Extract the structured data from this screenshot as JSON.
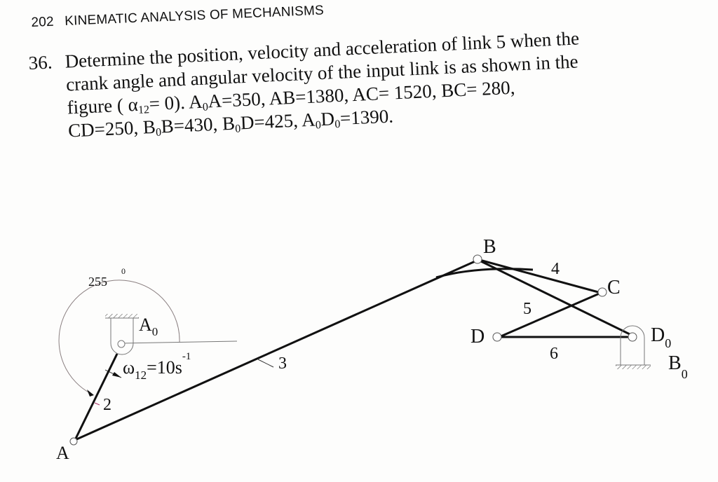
{
  "header": {
    "page_number": "202",
    "chapter_title": "KINEMATIC ANALYSIS OF MECHANISMS"
  },
  "problem": {
    "number": "36.",
    "line1": "Determine the position, velocity and acceleration of link 5 when the",
    "line2": "crank angle and angular velocity of the input link is as shown in the",
    "line3_prefix": "figure ( α",
    "line3_sub": "12",
    "line3_mid": "= 0).  A",
    "line3_sub2": "0",
    "line3_rest": "A=350,   AB=1380,  AC= 1520,  BC= 280,",
    "line4_a": "CD=250,  B",
    "line4_sub1": "0",
    "line4_b": "B=430, B",
    "line4_sub2": "0",
    "line4_c": "D=425,  A",
    "line4_sub3": "0",
    "line4_d": "D",
    "line4_sub4": "0",
    "line4_e": "=1390."
  },
  "diagram": {
    "angle_label": "255",
    "angle_degree": "0",
    "point_labels": {
      "A0": "A",
      "A0_sub": "0",
      "A": "A",
      "B": "B",
      "C": "C",
      "D": "D",
      "D0": "D",
      "D0_sub": "0",
      "B0": "B",
      "B0_sub": "0"
    },
    "omega_label": "ω",
    "omega_sub": "12",
    "omega_value": "=10s",
    "omega_exp": "-1",
    "link_labels": {
      "link2": "2",
      "link3": "3",
      "link4": "4",
      "link5": "5",
      "link6": "6"
    }
  }
}
